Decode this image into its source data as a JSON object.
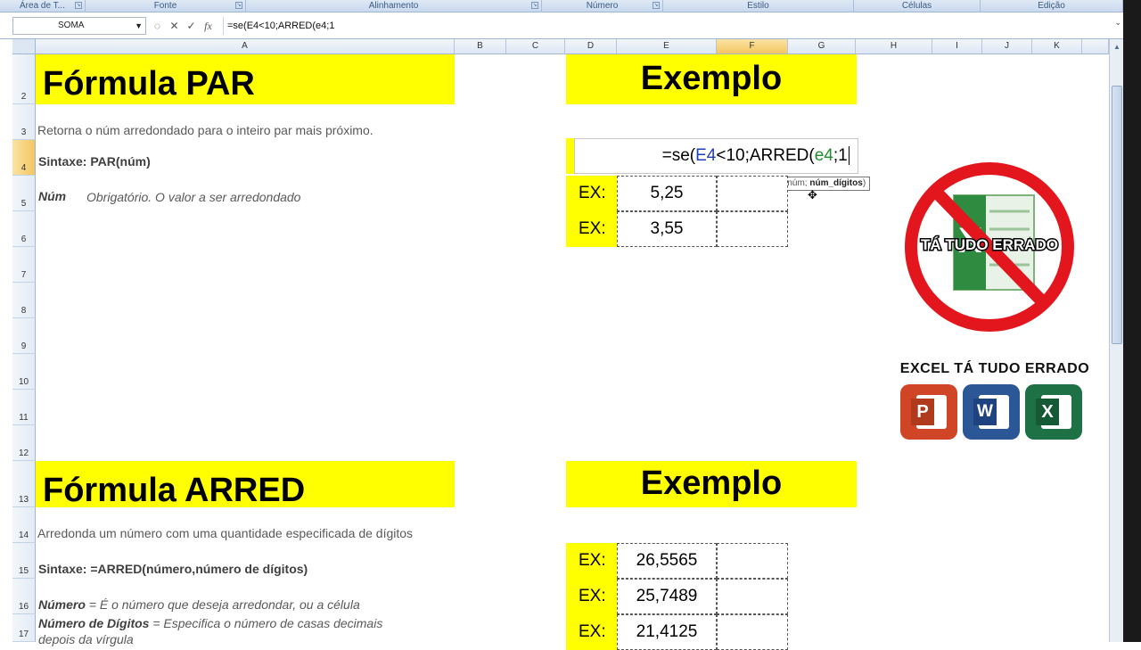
{
  "ribbon": {
    "groups": [
      "Área de T...",
      "Fonte",
      "Alinhamento",
      "Número",
      "Estilo",
      "Células",
      "Edição"
    ]
  },
  "formula_bar": {
    "name_box": "SOMA",
    "fx": "fx",
    "content": "=se(E4<10;ARRED(e4;1"
  },
  "columns": [
    "A",
    "B",
    "C",
    "D",
    "E",
    "F",
    "G",
    "H",
    "I",
    "J",
    "K"
  ],
  "rows": [
    "2",
    "3",
    "4",
    "5",
    "6",
    "7",
    "8",
    "9",
    "10",
    "11",
    "12",
    "13",
    "14",
    "15",
    "16",
    "17"
  ],
  "section1": {
    "title": "Fórmula PAR",
    "description": "Retorna o núm arredondado para o inteiro par mais próximo.",
    "syntax": "Sintaxe: PAR(núm)",
    "arg_name": "Núm",
    "arg_desc": "Obrigatório. O valor a ser arredondado"
  },
  "example1": {
    "title": "Exemplo",
    "editing": {
      "p1": "=se(",
      "ref1": "E4",
      "p2": "<10;ARRED(",
      "ref2": "e4",
      "p3": ";1"
    },
    "tooltip": {
      "fn": "ARRED(núm; ",
      "arg": "núm_dígitos",
      "end": ")"
    },
    "rows": [
      {
        "label": "EX:",
        "value": "5,25"
      },
      {
        "label": "EX:",
        "value": "3,55"
      }
    ]
  },
  "section2": {
    "title": "Fórmula ARRED",
    "description": "Arredonda um número com uma quantidade especificada de dígitos",
    "syntax": "Sintaxe: =ARRED(número,número de dígitos)",
    "arg1_name": "Número",
    "arg1_desc": " = É o número que deseja arredondar, ou a célula",
    "arg2_name": "Número de Dígitos",
    "arg2_desc": " = Especifica o número de casas decimais",
    "arg2_desc_cont": "depois da vírgula"
  },
  "example2": {
    "title": "Exemplo",
    "rows": [
      {
        "label": "EX:",
        "value": "26,5565"
      },
      {
        "label": "EX:",
        "value": "25,7489"
      },
      {
        "label": "EX:",
        "value": "21,4125"
      }
    ]
  },
  "overlay": {
    "stamp_text": "TÁ TUDO ERRADO",
    "caption": "EXCEL TÁ TUDO ERRADO",
    "icons": [
      {
        "letter": "P",
        "color": "#d04526"
      },
      {
        "letter": "W",
        "color": "#2b5797"
      },
      {
        "letter": "X",
        "color": "#1e7145"
      }
    ]
  },
  "colors": {
    "banner": "#ffff00",
    "no_sign": "#e3161e"
  }
}
